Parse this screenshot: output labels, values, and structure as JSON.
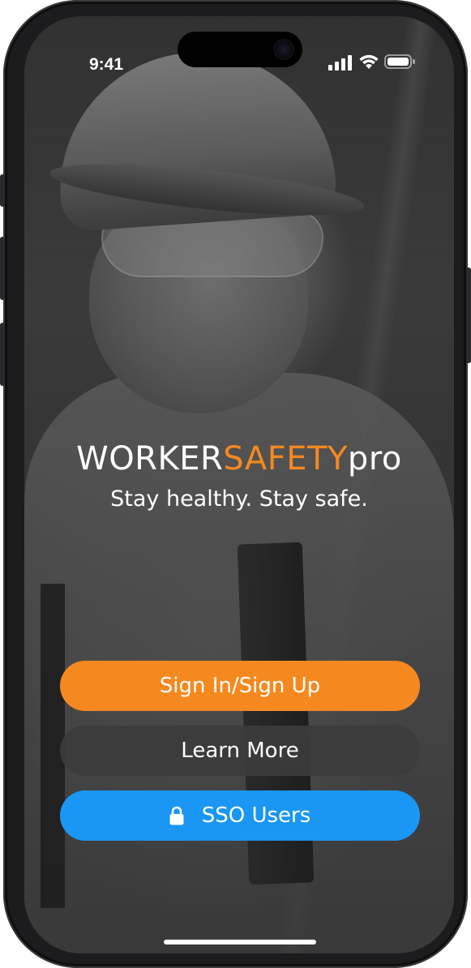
{
  "status_bar": {
    "time": "9:41",
    "icons": [
      "cellular-signal-icon",
      "wifi-icon",
      "battery-icon"
    ]
  },
  "brand": {
    "part1": "WORKER",
    "part2": "SAFETY",
    "part3": "pro",
    "accent_color": "#f5891f"
  },
  "tagline": "Stay healthy. Stay safe.",
  "buttons": {
    "sign_in": "Sign In/Sign Up",
    "learn_more": "Learn More",
    "sso": "SSO Users",
    "sso_icon": "lock-icon"
  },
  "colors": {
    "primary": "#f5891f",
    "secondary": "#3c3c3c",
    "sso": "#1a96f5"
  }
}
